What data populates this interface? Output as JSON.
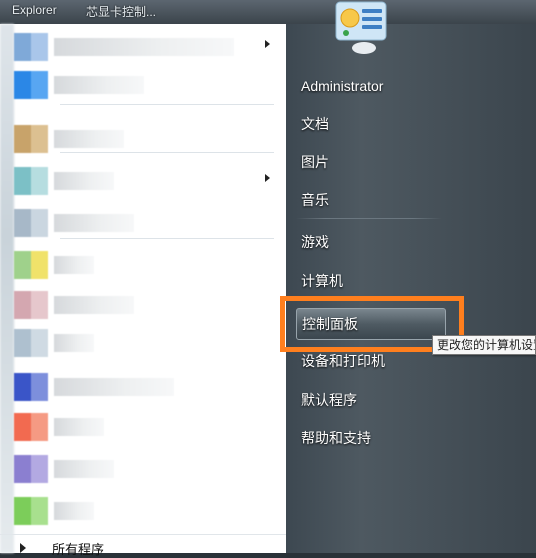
{
  "taskbar": {
    "window1": "Explorer",
    "window2": "芯显卡控制..."
  },
  "left": {
    "programs": [
      {
        "icon_colors": [
          "#7fa9d8",
          "#a9c6ea"
        ],
        "label_width": 180,
        "submenu": true
      },
      {
        "icon_colors": [
          "#2b87e6",
          "#58a6f2"
        ],
        "label_width": 90,
        "submenu": false
      },
      {
        "icon_colors": [
          "#c8a36a",
          "#dcc091"
        ],
        "label_width": 70,
        "submenu": false
      },
      {
        "icon_colors": [
          "#7cc0c6",
          "#b6dde0"
        ],
        "label_width": 60,
        "submenu": true
      },
      {
        "icon_colors": [
          "#a7b8c8",
          "#cad6e0"
        ],
        "label_width": 80,
        "submenu": false
      },
      {
        "icon_colors": [
          "#9fd18b",
          "#f0e26a"
        ],
        "label_width": 40,
        "submenu": false
      },
      {
        "icon_colors": [
          "#d4a7b0",
          "#e6c7cc"
        ],
        "label_width": 80,
        "submenu": false
      },
      {
        "icon_colors": [
          "#aec0cf",
          "#cfdae3"
        ],
        "label_width": 40,
        "submenu": false
      },
      {
        "icon_colors": [
          "#3a55c8",
          "#7d8fdc"
        ],
        "label_width": 120,
        "submenu": false
      },
      {
        "icon_colors": [
          "#f26a50",
          "#f59a83"
        ],
        "label_width": 50,
        "submenu": false
      },
      {
        "icon_colors": [
          "#8b7fd0",
          "#b3a9e2"
        ],
        "label_width": 60,
        "submenu": false
      },
      {
        "icon_colors": [
          "#7ccd5a",
          "#a8e08e"
        ],
        "label_width": 40,
        "submenu": false
      }
    ],
    "all_programs": "所有程序"
  },
  "right": {
    "items": [
      {
        "label": "Administrator",
        "id": "administrator"
      },
      {
        "label": "文档",
        "id": "documents"
      },
      {
        "label": "图片",
        "id": "pictures"
      },
      {
        "label": "音乐",
        "id": "music"
      },
      {
        "label": "游戏",
        "id": "games"
      },
      {
        "label": "计算机",
        "id": "computer"
      },
      {
        "label": "控制面板",
        "id": "control-panel"
      },
      {
        "label": "设备和打印机",
        "id": "devices-printers"
      },
      {
        "label": "默认程序",
        "id": "default-programs"
      },
      {
        "label": "帮助和支持",
        "id": "help-support"
      }
    ],
    "highlighted": "control-panel"
  },
  "tooltip": {
    "text": "更改您的计算机设置"
  }
}
